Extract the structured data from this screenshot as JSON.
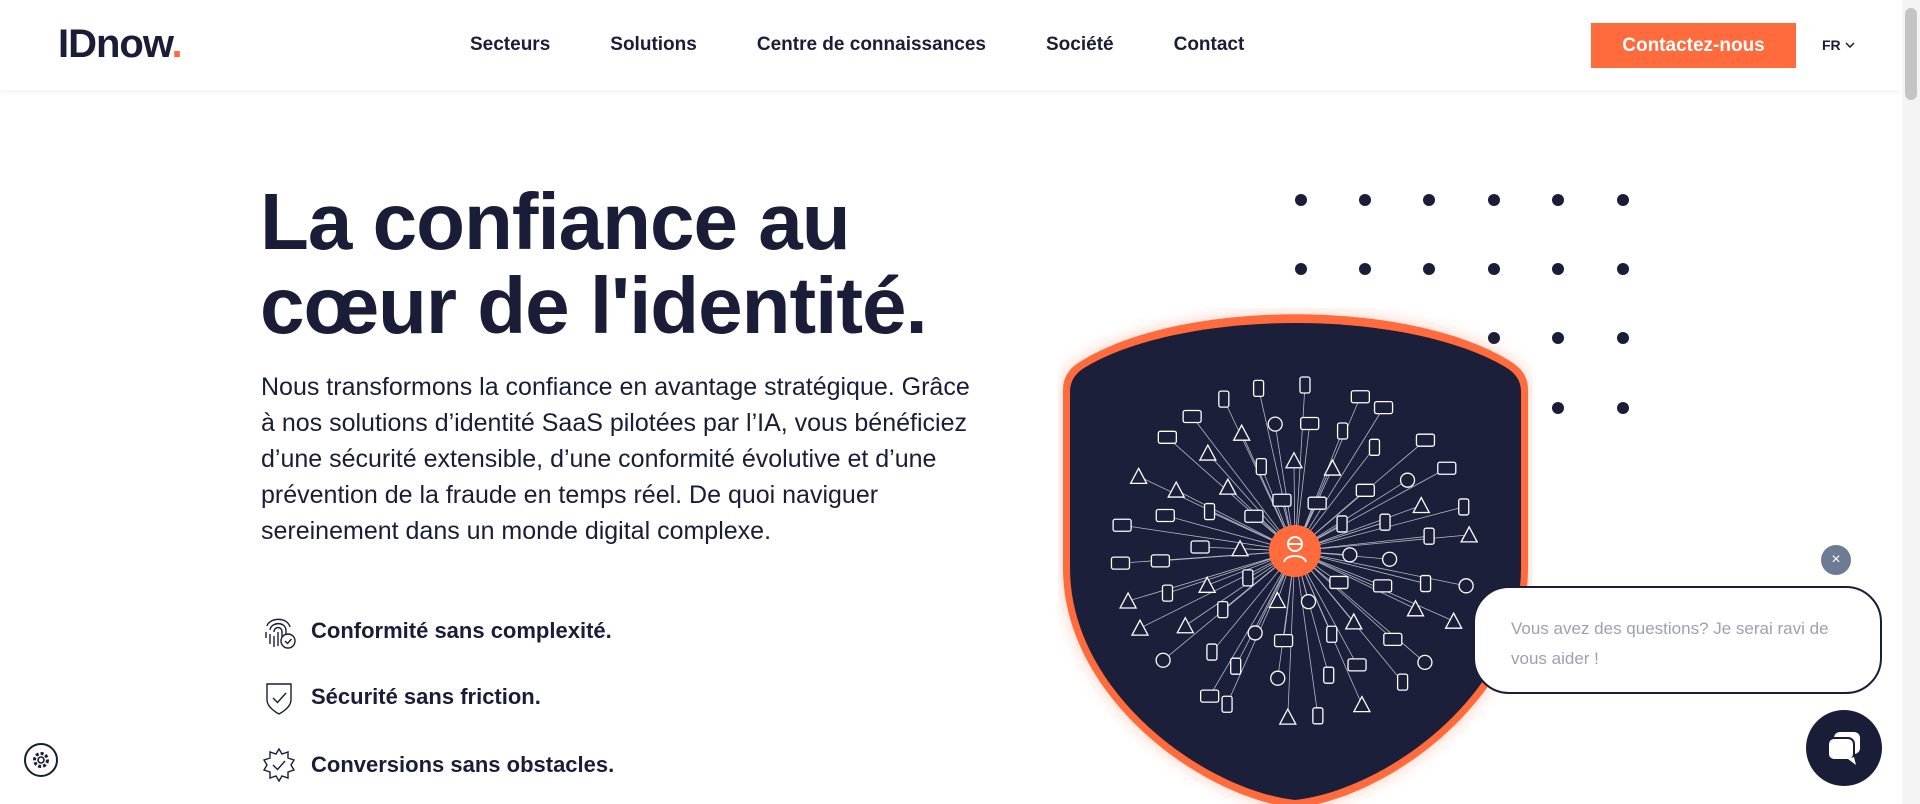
{
  "header": {
    "logo": {
      "text": "IDnow",
      "dot": "."
    },
    "nav": [
      {
        "label": "Secteurs"
      },
      {
        "label": "Solutions"
      },
      {
        "label": "Centre de connaissances"
      },
      {
        "label": "Société"
      },
      {
        "label": "Contact"
      }
    ],
    "cta_label": "Contactez-nous",
    "language": "FR"
  },
  "hero": {
    "title_line1": "La confiance au",
    "title_line2": "cœur de l'identité.",
    "description": "Nous transformons la confiance en avantage stratégique. Grâce à nos solutions d’identité SaaS pilotées par l’IA, vous bénéficiez d’une sécurité extensible, d’une conformité évolutive et d’une prévention de la fraude en temps réel. De quoi naviguer sereinement dans un monde digital complexe.",
    "features": [
      {
        "label": "Conformité sans complexité.",
        "icon": "fingerprint-icon"
      },
      {
        "label": "Sécurité sans friction.",
        "icon": "shield-check-icon"
      },
      {
        "label": "Conversions sans obstacles.",
        "icon": "gear-check-icon"
      }
    ]
  },
  "chat": {
    "message": "Vous avez des questions? Je serai ravi de vous aider !",
    "close_glyph": "×"
  },
  "colors": {
    "navy": "#1a1d37",
    "accent": "#ff6b3d",
    "close_button": "#6d7b94"
  }
}
